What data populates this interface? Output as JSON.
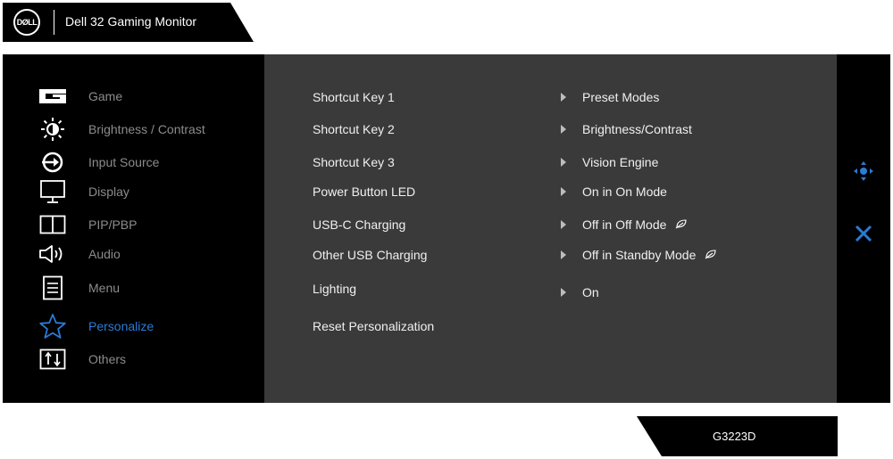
{
  "header": {
    "logo_text": "DØLL",
    "title": "Dell 32 Gaming Monitor"
  },
  "sidebar": {
    "items": [
      {
        "label": "Game",
        "icon": "game-icon"
      },
      {
        "label": "Brightness / Contrast",
        "icon": "brightness-icon"
      },
      {
        "label": "Input Source",
        "icon": "input-source-icon"
      },
      {
        "label": "Display",
        "icon": "display-icon"
      },
      {
        "label": "PIP/PBP",
        "icon": "pip-pbp-icon"
      },
      {
        "label": "Audio",
        "icon": "speaker-icon"
      },
      {
        "label": "Menu",
        "icon": "menu-icon"
      },
      {
        "label": "Personalize",
        "icon": "star-icon",
        "active": true
      },
      {
        "label": "Others",
        "icon": "others-icon"
      }
    ]
  },
  "content": {
    "rows": [
      {
        "label": "Shortcut Key 1",
        "value": "Preset Modes"
      },
      {
        "label": "Shortcut Key 2",
        "value": "Brightness/Contrast"
      },
      {
        "label": "Shortcut Key 3",
        "value": "Vision Engine"
      },
      {
        "label": "Power Button LED",
        "value": "On in On Mode"
      },
      {
        "label": "USB-C Charging",
        "value": "Off in Off Mode",
        "eco": true
      },
      {
        "label": "Other USB Charging",
        "value": "Off in Standby Mode",
        "eco": true
      },
      {
        "label": "Lighting",
        "value": "On"
      },
      {
        "label": "Reset Personalization",
        "value": ""
      }
    ]
  },
  "controls": {
    "navigate_icon": "navigate-icon",
    "close_icon": "close-icon"
  },
  "footer": {
    "model": "G3223D"
  },
  "colors": {
    "accent": "#2b7bd6",
    "inactive_text": "#8c8c8c",
    "content_bg": "#3a3a3a"
  }
}
